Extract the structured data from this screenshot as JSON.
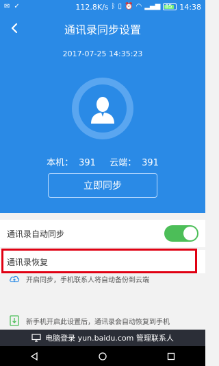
{
  "status_bar": {
    "speed": "112.8K/s",
    "battery": "85",
    "time": "14:38"
  },
  "header": {
    "title": "通讯录同步设置",
    "datetime": "2017-07-25  14:35:23"
  },
  "counts": {
    "local_label": "本机：",
    "local_value": "391",
    "cloud_label": "云端：",
    "cloud_value": "391"
  },
  "sync_button": "立即同步",
  "auto_sync": {
    "label": "通讯录自动同步",
    "enabled": true
  },
  "restore_label": "通讯录恢复",
  "info": {
    "line1": "开启同步，手机联系人将自动备份到云端",
    "line2": "新手机开启此设置后，通讯录会自动恢复到手机"
  },
  "pc_bar": "电脑登录 yun.baidu.com 管理联系人",
  "colors": {
    "primary": "#2a8ae6",
    "toggle_on": "#4cbe58",
    "highlight": "#e00012"
  }
}
